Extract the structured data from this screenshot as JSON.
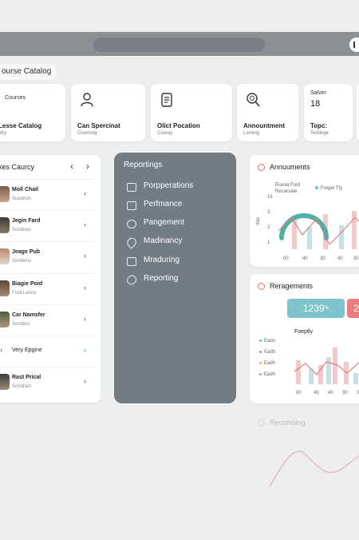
{
  "breadcrumb": "ourse Catalog",
  "tiles": [
    {
      "icon": "book-icon",
      "title": "Lesse Catalog",
      "sub": "ntry"
    },
    {
      "icon": "person-icon",
      "title": "Can Spercinat",
      "sub": "Courning"
    },
    {
      "icon": "document-icon",
      "title": "Olict Pocation",
      "sub": "Couray"
    },
    {
      "icon": "magnifier-icon",
      "title": "Annountment",
      "sub": "Lorning"
    },
    {
      "icon": "",
      "title": "Topc:",
      "sub": "Terdinge"
    }
  ],
  "tile0_label": "Courses",
  "tile4_top": "Salver",
  "tile4_value": "18",
  "list": {
    "title": "kes Caurcy",
    "rows": [
      {
        "name": "Moll Chail",
        "sub": "Suednsh"
      },
      {
        "name": "Jegin Fard",
        "sub": "Sordines"
      },
      {
        "name": "Jeage Pub",
        "sub": "Sordems"
      },
      {
        "name": "Biagie Poid",
        "sub": "Frod Lance"
      },
      {
        "name": "Car Namsfer",
        "sub": "Sonders"
      },
      {
        "name": "Very Epgine",
        "sub": ""
      },
      {
        "name": "Rast Prical",
        "sub": "Sondract"
      }
    ]
  },
  "reporting": {
    "title": "Reportings",
    "items": [
      {
        "icon": "folder-icon",
        "label": "Porpperations"
      },
      {
        "icon": "bookmark-icon",
        "label": "Perfmance"
      },
      {
        "icon": "grid-icon",
        "label": "Pangement"
      },
      {
        "icon": "drop-icon",
        "label": "Madinancy"
      },
      {
        "icon": "layers-icon",
        "label": "Mraduring"
      },
      {
        "icon": "link-icon",
        "label": "Reporting"
      }
    ]
  },
  "announcements": {
    "title": "Annuuments",
    "label_a": "Eranla Ford",
    "label_b": "Recarsate",
    "legend": "Freget Tfy",
    "ylabel": "Itas",
    "y_ticks": [
      "16",
      "3",
      "2",
      "1"
    ],
    "x_ticks": [
      "00",
      "40",
      "30",
      "40",
      "30"
    ]
  },
  "engagements": {
    "title": "Reragements",
    "stat": "1239",
    "stat_unit": "%",
    "stat2": "2",
    "sub": "Foeptly",
    "legend": [
      "Eadn",
      "Eadh",
      "Eadh",
      "Eadh"
    ],
    "x_ticks": [
      "00",
      "40",
      "40",
      "30",
      "30"
    ]
  },
  "recording": {
    "title": "Reconsiing"
  }
}
